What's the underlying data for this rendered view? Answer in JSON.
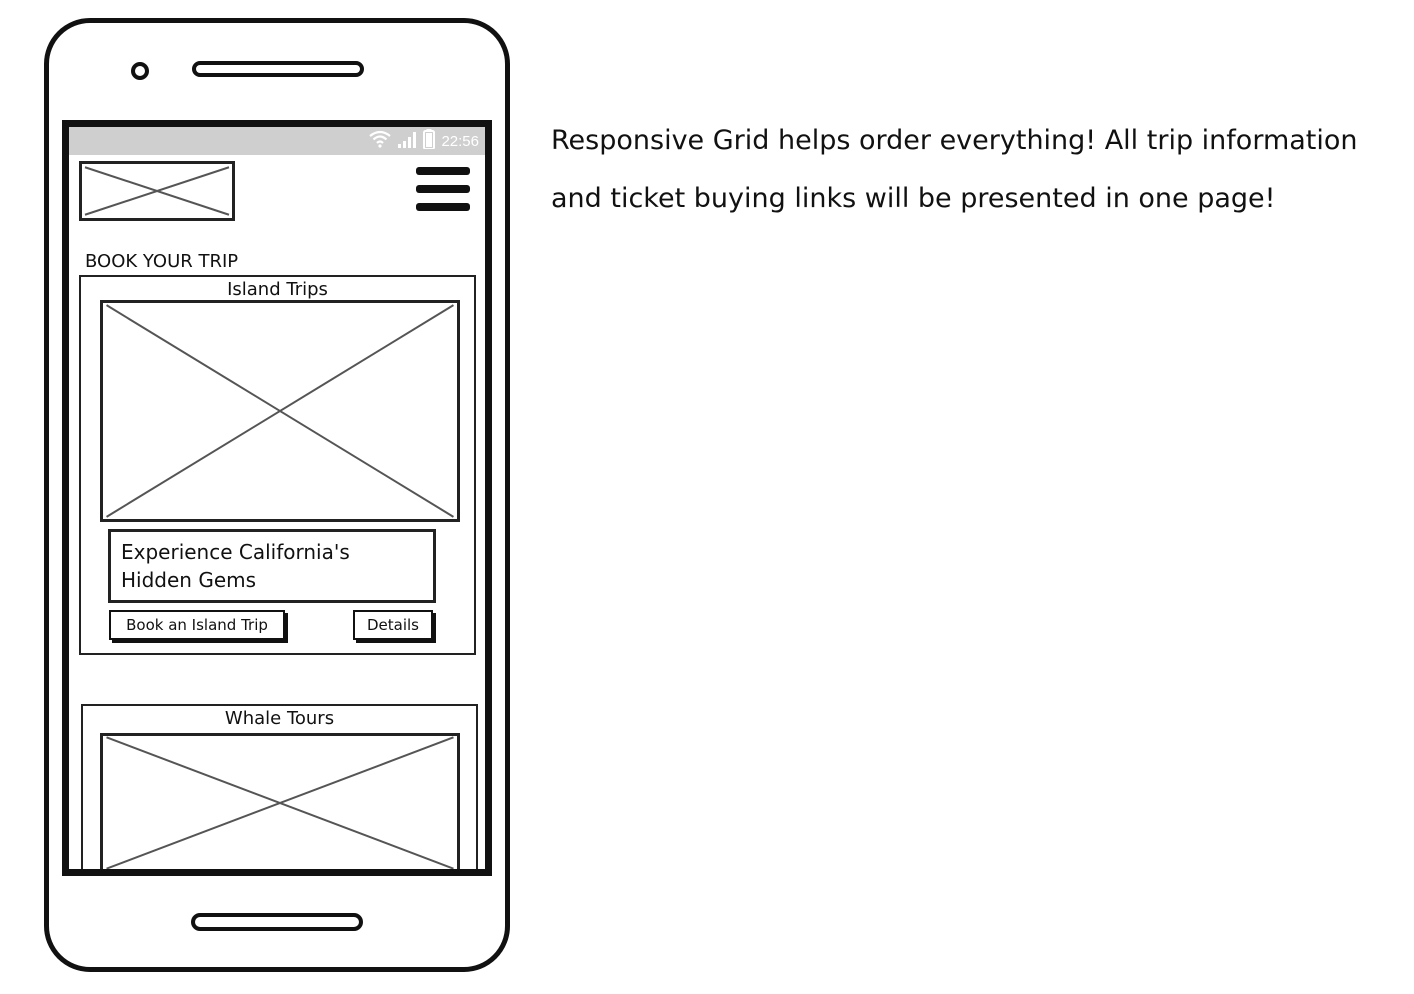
{
  "status_bar": {
    "time": "22:56",
    "icons": [
      "wifi-icon",
      "signal-icon",
      "battery-icon"
    ]
  },
  "header": {
    "logo": "image-placeholder",
    "menu_icon": "hamburger-icon"
  },
  "section": {
    "title": "BOOK YOUR TRIP"
  },
  "cards": [
    {
      "title": "Island Trips",
      "image": "image-placeholder",
      "tagline": "Experience California's\nHidden Gems",
      "primary_button": "Book an Island Trip",
      "secondary_button": "Details"
    },
    {
      "title": "Whale Tours",
      "image": "image-placeholder"
    }
  ],
  "annotation": {
    "line1": "Responsive Grid helps order everything! All trip information",
    "line2": " and ticket buying links will be presented in one page!"
  },
  "colors": {
    "outline": "#111111",
    "status_bar": "#cfcfcf",
    "placeholder_cross": "#555555"
  }
}
